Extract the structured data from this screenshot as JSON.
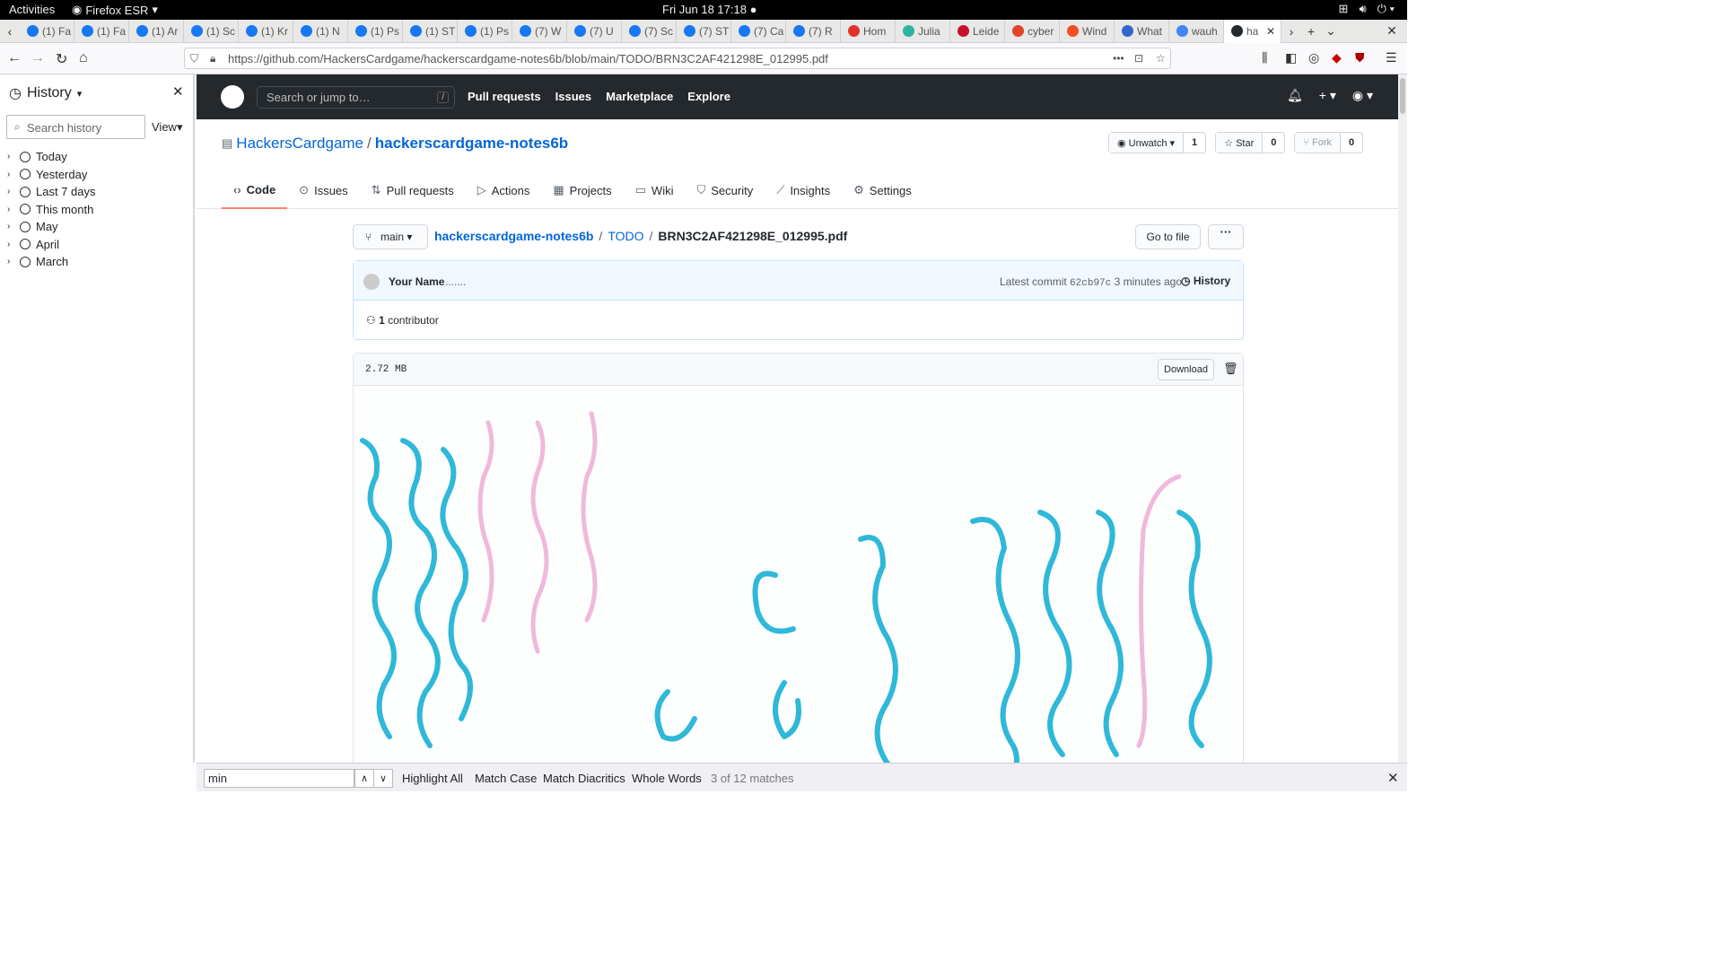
{
  "system": {
    "activities": "Activities",
    "app_name": "Firefox ESR",
    "clock": "Fri Jun 18  17:18"
  },
  "tabs": [
    {
      "label": "(1) Fa",
      "icon": "facebook-icon"
    },
    {
      "label": "(1) Fa",
      "icon": "facebook-icon"
    },
    {
      "label": "(1) Ar",
      "icon": "facebook-icon"
    },
    {
      "label": "(1) Sc",
      "icon": "facebook-icon"
    },
    {
      "label": "(1) Kr",
      "icon": "facebook-icon"
    },
    {
      "label": "(1) N",
      "icon": "facebook-icon"
    },
    {
      "label": "(1) Ps",
      "icon": "facebook-icon"
    },
    {
      "label": "(1) ST",
      "icon": "facebook-icon"
    },
    {
      "label": "(1) Ps",
      "icon": "facebook-icon"
    },
    {
      "label": "(7) W",
      "icon": "facebook-icon"
    },
    {
      "label": "(7) U",
      "icon": "facebook-icon"
    },
    {
      "label": "(7) Sc",
      "icon": "facebook-icon"
    },
    {
      "label": "(7) ST",
      "icon": "facebook-icon"
    },
    {
      "label": "(7) Ca",
      "icon": "facebook-icon"
    },
    {
      "label": "(7) R",
      "icon": "facebook-icon"
    },
    {
      "label": "Hom",
      "icon": "record-icon"
    },
    {
      "label": "Julia",
      "icon": "julia-icon"
    },
    {
      "label": "Leide",
      "icon": "b-icon"
    },
    {
      "label": "cyber",
      "icon": "gitlab-icon"
    },
    {
      "label": "Wind",
      "icon": "windows-icon"
    },
    {
      "label": "What",
      "icon": "w-icon"
    },
    {
      "label": "wauh",
      "icon": "google-icon"
    },
    {
      "label": "ha",
      "icon": "github-icon",
      "active": true
    }
  ],
  "url": "https://github.com/HackersCardgame/hackerscardgame-notes6b/blob/main/TODO/BRN3C2AF421298E_012995.pdf",
  "sidebar": {
    "title": "History",
    "search_placeholder": "Search history",
    "view_label": "View",
    "items": [
      "Today",
      "Yesterday",
      "Last 7 days",
      "This month",
      "May",
      "April",
      "March"
    ]
  },
  "github": {
    "search_placeholder": "Search or jump to…",
    "slash": "/",
    "nav": [
      "Pull requests",
      "Issues",
      "Marketplace",
      "Explore"
    ],
    "owner": "HackersCardgame",
    "separator": "/",
    "repo": "hackerscardgame-notes6b",
    "unwatch_label": "Unwatch",
    "unwatch_count": "1",
    "star_label": "Star",
    "star_count": "0",
    "fork_label": "Fork",
    "fork_count": "0",
    "repo_tabs": [
      {
        "label": "Code",
        "icon": "code-icon",
        "selected": true
      },
      {
        "label": "Issues",
        "icon": "issue-icon"
      },
      {
        "label": "Pull requests",
        "icon": "pull-request-icon"
      },
      {
        "label": "Actions",
        "icon": "play-icon"
      },
      {
        "label": "Projects",
        "icon": "project-icon"
      },
      {
        "label": "Wiki",
        "icon": "book-icon"
      },
      {
        "label": "Security",
        "icon": "shield-icon"
      },
      {
        "label": "Insights",
        "icon": "graph-icon"
      },
      {
        "label": "Settings",
        "icon": "gear-icon"
      }
    ],
    "branch": "main",
    "breadcrumb": {
      "repo": "hackerscardgame-notes6b",
      "folder": "TODO",
      "file": "BRN3C2AF421298E_012995.pdf",
      "sep": "/"
    },
    "goto_file": "Go to file",
    "more": "···",
    "commit": {
      "author": "Your Name",
      "message": ".......",
      "latest_prefix": "Latest commit",
      "hash": "62cb97c",
      "time": "3 minutes ago",
      "history": "History",
      "contributors_count": "1",
      "contributors_label": "contributor"
    },
    "file": {
      "size": "2.72 MB",
      "download": "Download"
    }
  },
  "findbar": {
    "query": "min",
    "highlight_all": "Highlight All",
    "match_case": "Match Case",
    "match_diacritics": "Match Diacritics",
    "whole_words": "Whole Words",
    "matches": "3 of 12 matches"
  },
  "colors": {
    "github_header": "#24292e",
    "link": "#0366d6",
    "selected_tab_underline": "#f9826c",
    "ink_blue": "#2fb8d8",
    "ink_pink": "#f0b8dc"
  }
}
